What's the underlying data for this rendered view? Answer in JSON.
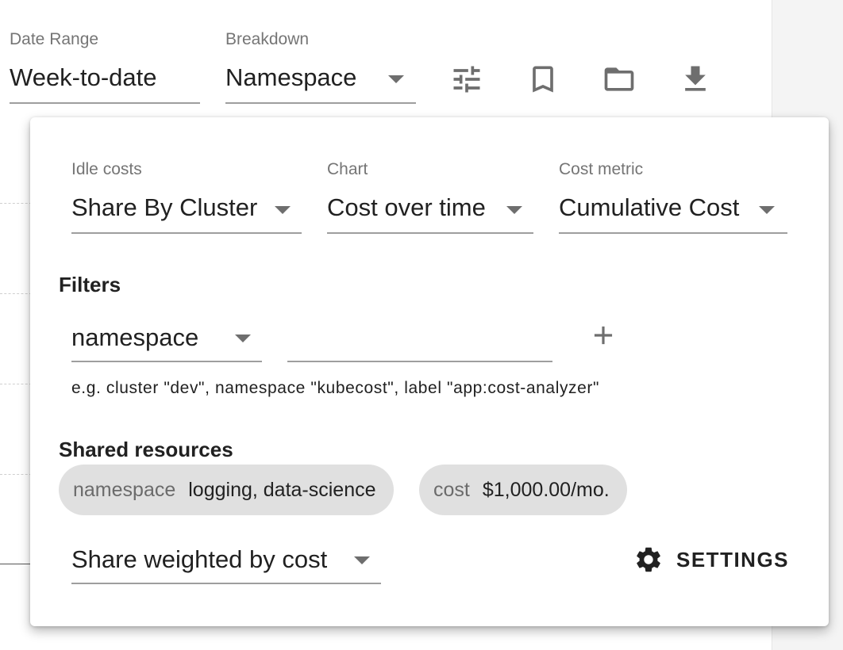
{
  "toolbar": {
    "date_range": {
      "label": "Date Range",
      "value": "Week-to-date"
    },
    "breakdown": {
      "label": "Breakdown",
      "value": "Namespace"
    },
    "icons": [
      "tune-icon",
      "bookmark-icon",
      "folder-icon",
      "download-icon"
    ]
  },
  "popover": {
    "idle_costs": {
      "label": "Idle costs",
      "value": "Share By Cluster"
    },
    "chart": {
      "label": "Chart",
      "value": "Cost over time"
    },
    "cost_metric": {
      "label": "Cost metric",
      "value": "Cumulative Cost"
    },
    "filters": {
      "title": "Filters",
      "type_value": "namespace",
      "text_value": "",
      "helper": "e.g. cluster \"dev\", namespace \"kubecost\", label \"app:cost-analyzer\""
    },
    "shared_resources": {
      "title": "Shared resources",
      "chips": [
        {
          "key": "namespace",
          "value": "logging, data-science"
        },
        {
          "key": "cost",
          "value": "$1,000.00/mo."
        }
      ]
    },
    "share_mode": {
      "value": "Share weighted by cost"
    },
    "settings_label": "SETTINGS"
  },
  "colors": {
    "text": "#212121",
    "label": "#757575",
    "chip_bg": "#e0e0e0",
    "icon": "#6e6e6e"
  }
}
